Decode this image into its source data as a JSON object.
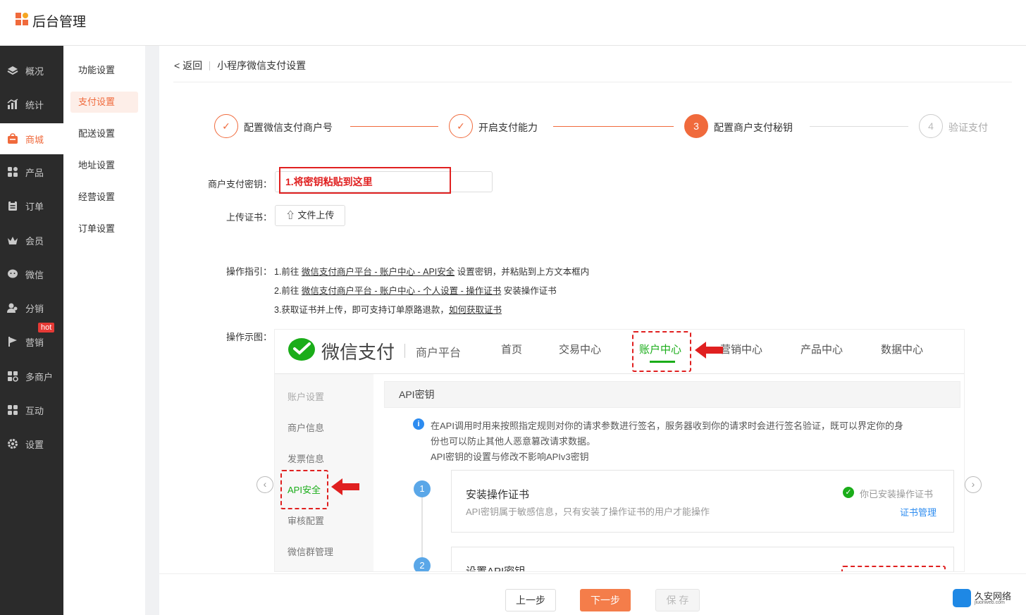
{
  "app": {
    "title": "后台管理"
  },
  "sidebar": {
    "items": [
      {
        "label": "概况",
        "icon": "dashboard-icon"
      },
      {
        "label": "统计",
        "icon": "chart-icon"
      },
      {
        "label": "商城",
        "icon": "store-icon",
        "active": true
      },
      {
        "label": "产品",
        "icon": "grid-icon"
      },
      {
        "label": "订单",
        "icon": "order-icon"
      },
      {
        "label": "会员",
        "icon": "crown-icon"
      },
      {
        "label": "微信",
        "icon": "wechat-icon"
      },
      {
        "label": "分销",
        "icon": "users-icon"
      },
      {
        "label": "营销",
        "icon": "flag-icon",
        "badge": "hot"
      },
      {
        "label": "多商户",
        "icon": "merchant-icon"
      },
      {
        "label": "互动",
        "icon": "interact-icon"
      },
      {
        "label": "设置",
        "icon": "gear-icon"
      }
    ]
  },
  "subnav": {
    "items": [
      {
        "label": "功能设置"
      },
      {
        "label": "支付设置",
        "active": true
      },
      {
        "label": "配送设置"
      },
      {
        "label": "地址设置"
      },
      {
        "label": "经营设置"
      },
      {
        "label": "订单设置"
      }
    ]
  },
  "breadcrumb": {
    "back": "< 返回",
    "title": "小程序微信支付设置"
  },
  "steps": [
    {
      "label": "配置微信支付商户号",
      "state": "done"
    },
    {
      "label": "开启支付能力",
      "state": "done"
    },
    {
      "number": "3",
      "label": "配置商户支付秘钥",
      "state": "current"
    },
    {
      "number": "4",
      "label": "验证支付",
      "state": "pending"
    }
  ],
  "form": {
    "key_label": "商户支付密钥：",
    "key_value": "",
    "key_annotation": "1.将密钥粘贴到这里",
    "cert_label": "上传证书：",
    "upload_button": "文件上传",
    "guide_label": "操作指引：",
    "guide": {
      "line1_prefix": "1.前往 ",
      "line1_link": "微信支付商户平台 - 账户中心 - API安全",
      "line1_suffix": " 设置密钥，并粘贴到上方文本框内",
      "line2_prefix": "2.前往 ",
      "line2_link": "微信支付商户平台 - 账户中心 - 个人设置 - 操作证书",
      "line2_suffix": " 安装操作证书",
      "line3_prefix": "3.获取证书并上传，即可支持订单原路退款，",
      "line3_link": "如何获取证书"
    },
    "demo_label": "操作示图："
  },
  "demo": {
    "brand": "微信支付",
    "platform": "商户平台",
    "nav": [
      "首页",
      "交易中心",
      "账户中心",
      "营销中心",
      "产品中心",
      "数据中心"
    ],
    "left_items": [
      "账户设置",
      "商户信息",
      "发票信息",
      "API安全",
      "审核配置",
      "微信群管理"
    ],
    "panel_title": "API密钥",
    "info_line1": "在API调用时用来按照指定规则对你的请求参数进行签名，服务器收到你的请求时会进行签名验证，既可以界定你的身",
    "info_line2": "份也可以防止其他人恶意篡改请求数据。",
    "info_line3": "API密钥的设置与修改不影响APIv3密钥",
    "card1": {
      "num": "1",
      "title": "安装操作证书",
      "desc": "API密钥属于敏感信息，只有安装了操作证书的用户才能操作",
      "status": "你已安装操作证书",
      "link": "证书管理"
    },
    "card2": {
      "num": "2",
      "title": "设置API密钥"
    }
  },
  "footer": {
    "prev": "上一步",
    "next": "下一步",
    "save": "保 存"
  },
  "watermark": {
    "name": "久安网络",
    "url": "jiuonweb.com"
  },
  "colors": {
    "accent": "#f06a3c",
    "wechat_green": "#1aad19",
    "annotation_red": "#e02020"
  }
}
